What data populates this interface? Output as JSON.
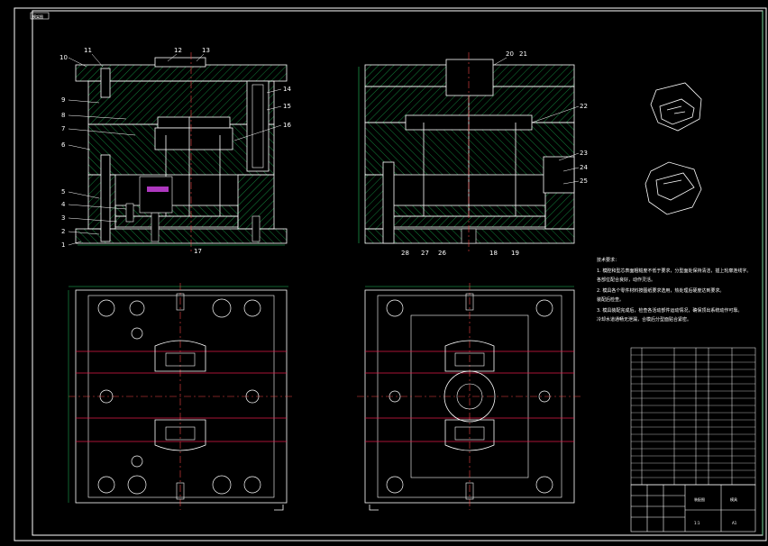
{
  "drawing": {
    "corner_tag": "模架图",
    "colors": {
      "background": "#000000",
      "outline": "#ffffff",
      "hatch": "#16a34a",
      "centerline": "#ef4444",
      "dimension": "#22c55e",
      "accent": "#e11d48",
      "highlight": "#d946ef"
    },
    "section_a": {
      "callouts": [
        "1",
        "2",
        "3",
        "4",
        "5",
        "6",
        "7",
        "8",
        "9",
        "10",
        "11",
        "12",
        "13",
        "14",
        "15",
        "16",
        "17"
      ]
    },
    "section_b": {
      "callouts": [
        "18",
        "19",
        "20",
        "21",
        "22",
        "23",
        "24",
        "25",
        "26",
        "27",
        "28"
      ]
    },
    "tech_requirements": {
      "title": "技术要求：",
      "lines": [
        "1. 模腔和型芯表面粗糙度不低于要求，分型面处保持清洁，插上轮廓连线字。",
        "各部位配合良好，动作灵活。",
        "2. 模具各个零件材料按图纸要求选用，热处理后硬度达到要求。",
        "装配后检查。",
        "3. 模具装配完成后，检查各活动部件运动情况，确保顶出系统动作可靠。",
        "冷却水道通畅无泄漏，合模后分型面贴合紧密。"
      ]
    },
    "title_block": {
      "drawing_title": "装配图",
      "code": "模具",
      "scale": "1:1",
      "sheet": "A1"
    }
  }
}
